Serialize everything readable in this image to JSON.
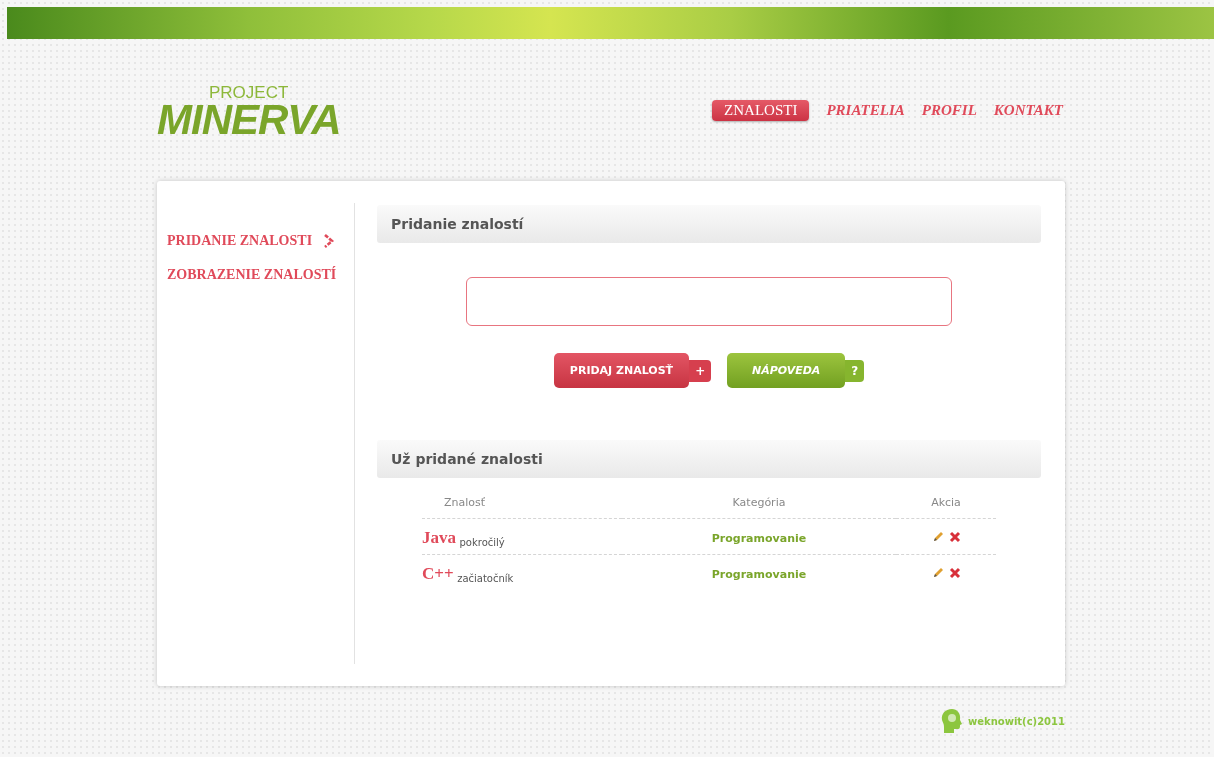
{
  "logo": {
    "small": "PROJECT",
    "big": "MINERVA"
  },
  "nav": [
    {
      "label": "ZNALOSTI",
      "selected": true
    },
    {
      "label": "PRIATELIA",
      "selected": false
    },
    {
      "label": "PROFIL",
      "selected": false
    },
    {
      "label": "KONTAKT",
      "selected": false
    }
  ],
  "sidebar": {
    "items": [
      {
        "label": "PRIDANIE ZNALOSTI",
        "selected": true
      },
      {
        "label": "ZOBRAZENIE ZNALOSTÍ",
        "selected": false
      }
    ]
  },
  "add_section": {
    "title": "Pridanie znalostí",
    "buttons": [
      {
        "label": "PRIDAJ ZNALOSŤ",
        "tab": "+",
        "kind": "primary"
      },
      {
        "label": "NÁPOVEDA",
        "tab": "?",
        "kind": "help"
      }
    ]
  },
  "list_section": {
    "title": "Už pridané znalosti",
    "columns": [
      "Znalosť",
      "Kategória",
      "Akcia"
    ],
    "rows": [
      {
        "name": "Java",
        "level": "pokročilý",
        "category": "Programovanie"
      },
      {
        "name": "C++",
        "level": "začiatočník",
        "category": "Programovanie"
      }
    ]
  },
  "footer": {
    "text": "weknowit(c)2011"
  }
}
